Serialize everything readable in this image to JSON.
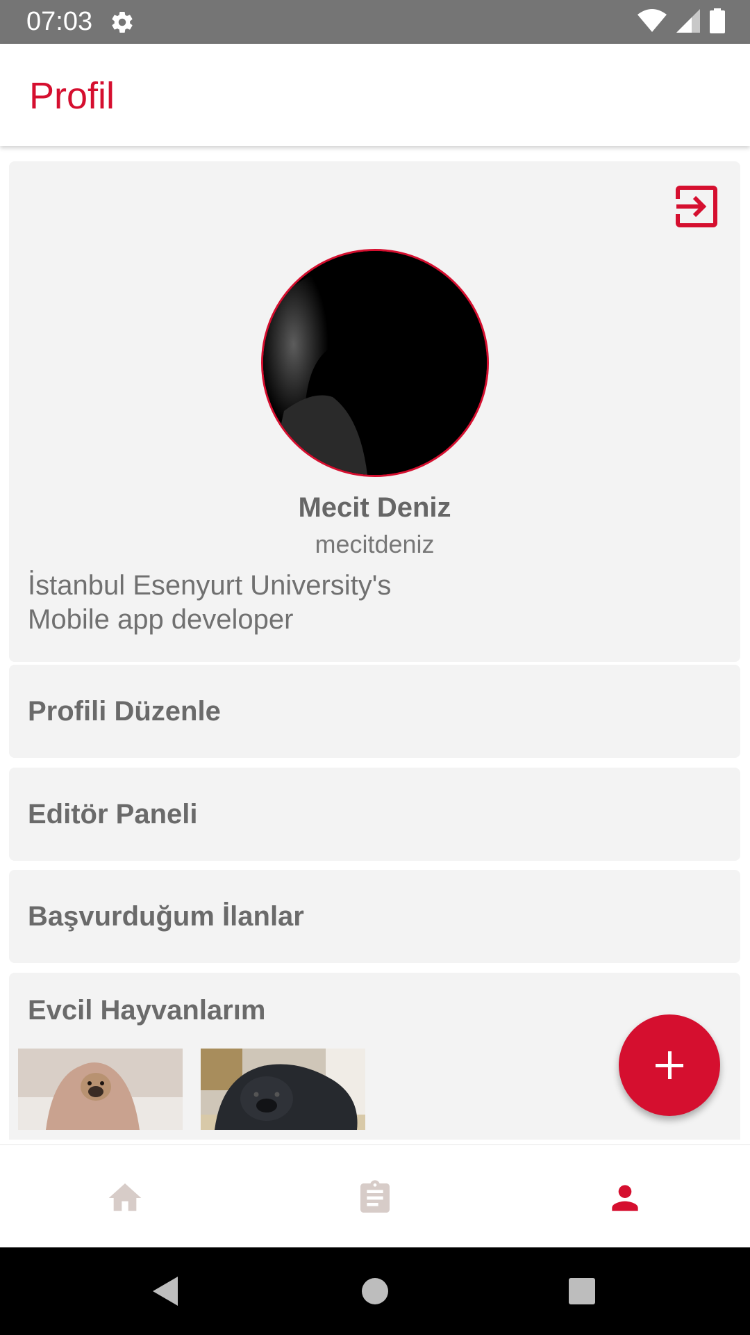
{
  "status_bar": {
    "time": "07:03",
    "icons": [
      "gear-icon",
      "wifi-icon",
      "signal-icon",
      "battery-icon"
    ]
  },
  "app_bar": {
    "title": "Profil"
  },
  "profile": {
    "name": "Mecit Deniz",
    "username": "mecitdeniz",
    "bio_line1": "İstanbul Esenyurt University's",
    "bio_line2": "Mobile app developer"
  },
  "menu": {
    "edit_profile": "Profili Düzenle",
    "editor_panel": "Editör Paneli",
    "applied_ads": "Başvurduğum İlanlar"
  },
  "pets": {
    "title": "Evcil Hayvanlarım"
  },
  "bottom_nav": {
    "items": [
      "home-icon",
      "clipboard-icon",
      "person-icon"
    ],
    "active": "person-icon"
  },
  "colors": {
    "accent": "#d50f2f",
    "card_bg": "#f3f3f3",
    "status_bar": "#757575",
    "nav_inactive": "#d7ccc8"
  }
}
